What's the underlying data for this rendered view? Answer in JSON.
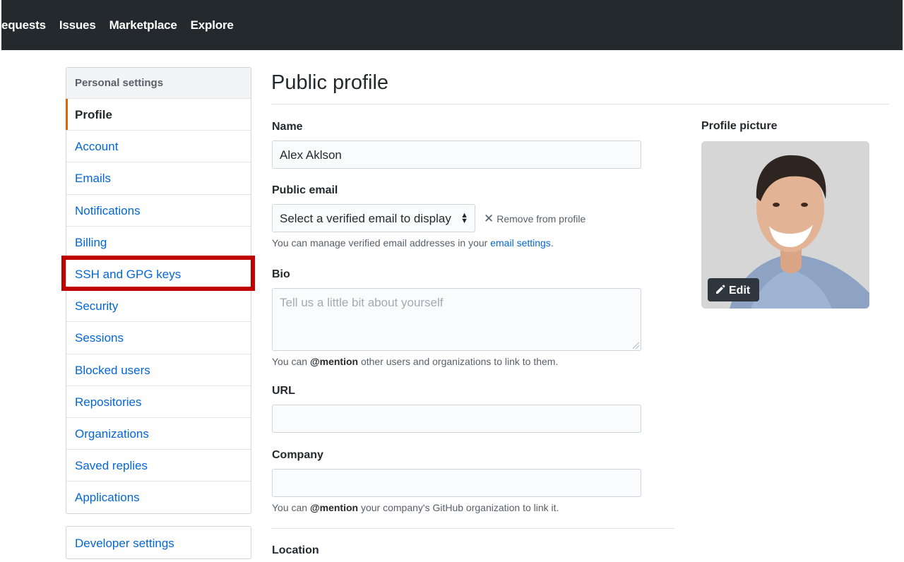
{
  "topnav": {
    "items": [
      "ll requests",
      "Issues",
      "Marketplace",
      "Explore"
    ]
  },
  "sidebar": {
    "header": "Personal settings",
    "items": [
      {
        "label": "Profile",
        "selected": true
      },
      {
        "label": "Account"
      },
      {
        "label": "Emails"
      },
      {
        "label": "Notifications"
      },
      {
        "label": "Billing"
      },
      {
        "label": "SSH and GPG keys",
        "highlighted": true
      },
      {
        "label": "Security"
      },
      {
        "label": "Sessions"
      },
      {
        "label": "Blocked users"
      },
      {
        "label": "Repositories"
      },
      {
        "label": "Organizations"
      },
      {
        "label": "Saved replies"
      },
      {
        "label": "Applications"
      }
    ],
    "developer_settings": "Developer settings"
  },
  "main": {
    "title": "Public profile",
    "name": {
      "label": "Name",
      "value": "Alex Aklson"
    },
    "public_email": {
      "label": "Public email",
      "selected": "Select a verified email to display",
      "remove_label": "Remove from profile",
      "note_prefix": "You can manage verified email addresses in your ",
      "note_link": "email settings",
      "note_suffix": "."
    },
    "bio": {
      "label": "Bio",
      "placeholder": "Tell us a little bit about yourself",
      "note_prefix": "You can ",
      "note_mention": "@mention",
      "note_suffix": " other users and organizations to link to them."
    },
    "url": {
      "label": "URL",
      "value": ""
    },
    "company": {
      "label": "Company",
      "value": "",
      "note_prefix": "You can ",
      "note_mention": "@mention",
      "note_suffix": " your company's GitHub organization to link it."
    },
    "location": {
      "label": "Location"
    }
  },
  "profile_picture": {
    "label": "Profile picture",
    "edit_label": "Edit"
  },
  "colors": {
    "topbar": "#24292e",
    "link": "#0366d6",
    "highlight": "#c00000",
    "selected_accent": "#e36209"
  }
}
